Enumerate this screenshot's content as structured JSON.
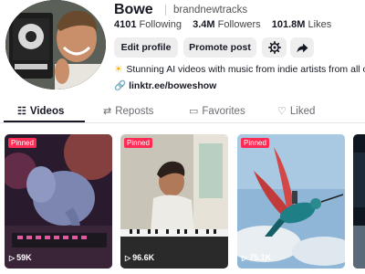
{
  "profile": {
    "name": "Bowe",
    "handle": "brandnewtracks",
    "avatar_alt": "profile photo"
  },
  "stats": {
    "following_count": "4101",
    "following_label": "Following",
    "followers_count": "3.4M",
    "followers_label": "Followers",
    "likes_count": "101.8M",
    "likes_label": "Likes"
  },
  "actions": {
    "edit_label": "Edit profile",
    "promote_label": "Promote post",
    "settings_icon": "gear-icon",
    "share_icon": "share-arrow-icon"
  },
  "bio": {
    "emoji": "☀",
    "text": "Stunning AI videos with music from indie artists from all ove",
    "link": "linktr.ee/boweshow"
  },
  "tabs": [
    {
      "label": "Videos",
      "icon": "grid-icon",
      "active": true
    },
    {
      "label": "Reposts",
      "icon": "repost-icon",
      "active": false
    },
    {
      "label": "Favorites",
      "icon": "bookmark-icon",
      "active": false
    },
    {
      "label": "Liked",
      "icon": "heart-icon",
      "active": false
    }
  ],
  "videos": [
    {
      "pinned": "Pinned",
      "views": "59K",
      "subject": "elephant playing synthesizer"
    },
    {
      "pinned": "Pinned",
      "views": "96.6K",
      "subject": "man playing piano"
    },
    {
      "pinned": "Pinned",
      "views": "75.1K",
      "subject": "hummingbird with rider"
    },
    {
      "pinned": "",
      "views": "",
      "subject": "partial thumbnail"
    }
  ],
  "colors": {
    "accent": "#fe2c55",
    "text": "#161823",
    "button_bg": "#eeeeef"
  }
}
